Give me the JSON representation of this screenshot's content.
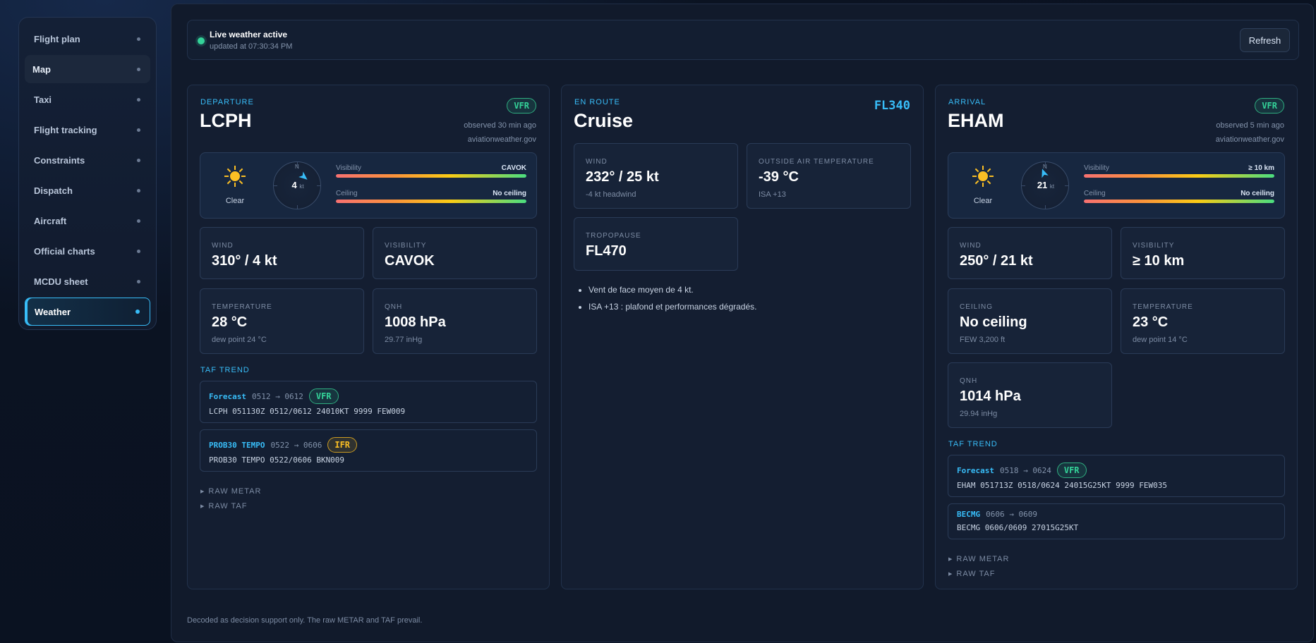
{
  "sidebar": {
    "items": [
      {
        "label": "Flight plan"
      },
      {
        "label": "Map"
      },
      {
        "label": "Taxi"
      },
      {
        "label": "Flight tracking"
      },
      {
        "label": "Constraints"
      },
      {
        "label": "Dispatch"
      },
      {
        "label": "Aircraft"
      },
      {
        "label": "Official charts"
      },
      {
        "label": "MCDU sheet"
      },
      {
        "label": "Weather"
      }
    ],
    "active": "Weather"
  },
  "status": {
    "title": "Live weather active",
    "updated": "updated at 07:30:34 PM",
    "refresh_label": "Refresh",
    "color": "#34d399"
  },
  "departure": {
    "label": "DEPARTURE",
    "code": "LCPH",
    "category": "VFR",
    "observed": "observed 30 min ago",
    "source": "aviationweather.gov",
    "sky": "Clear",
    "sky_icon": "sun-icon",
    "compass_n": "N",
    "wind_speed": "4",
    "wind_unit": "kt",
    "visibility_label": "Visibility",
    "visibility_short": "CAVOK",
    "ceiling_label": "Ceiling",
    "ceiling_short": "No ceiling",
    "tiles": {
      "wind_label": "WIND",
      "wind_value": "310° / 4 kt",
      "visibility_label": "VISIBILITY",
      "visibility_value": "CAVOK",
      "temperature_label": "TEMPERATURE",
      "temperature_value": "28 °C",
      "dew_point": "dew point 24 °C",
      "qnh_label": "QNH",
      "qnh_value": "1008 hPa",
      "qnh_inhg": "29.77 inHg"
    },
    "taf_title": "TAF TREND",
    "taf": [
      {
        "kind": "Forecast",
        "period": "0512 → 0612",
        "category": "VFR",
        "code": "LCPH 051130Z 0512/0612 24010KT 9999 FEW009"
      },
      {
        "kind": "PROB30 TEMPO",
        "period": "0522 → 0606",
        "category": "IFR",
        "code": "PROB30 TEMPO 0522/0606 BKN009"
      }
    ],
    "raw_metar": "RAW METAR",
    "raw_taf": "RAW TAF"
  },
  "enroute": {
    "label": "EN ROUTE",
    "title": "Cruise",
    "flight_level": "FL340",
    "tiles": {
      "wind_label": "WIND",
      "wind_value": "232° / 25 kt",
      "wind_sub": "-4 kt headwind",
      "oat_label": "OUTSIDE AIR TEMPERATURE",
      "oat_value": "-39 °C",
      "oat_sub": "ISA +13",
      "tropo_label": "TROPOPAUSE",
      "tropo_value": "FL470"
    },
    "notes": [
      "Vent de face moyen de 4 kt.",
      "ISA +13 : plafond et performances dégradés."
    ]
  },
  "arrival": {
    "label": "ARRIVAL",
    "code": "EHAM",
    "category": "VFR",
    "observed": "observed 5 min ago",
    "source": "aviationweather.gov",
    "sky": "Clear",
    "sky_icon": "sun-icon",
    "compass_n": "N",
    "wind_speed": "21",
    "wind_unit": "kt",
    "visibility_label": "Visibility",
    "visibility_short": "≥ 10 km",
    "ceiling_label": "Ceiling",
    "ceiling_short": "No ceiling",
    "tiles": {
      "wind_label": "WIND",
      "wind_value": "250° / 21 kt",
      "visibility_label": "VISIBILITY",
      "visibility_value": "≥ 10 km",
      "ceiling_label": "CEILING",
      "ceiling_value": "No ceiling",
      "ceiling_sub": "FEW 3,200 ft",
      "temperature_label": "TEMPERATURE",
      "temperature_value": "23 °C",
      "dew_point": "dew point 14 °C",
      "qnh_label": "QNH",
      "qnh_value": "1014 hPa",
      "qnh_inhg": "29.94 inHg"
    },
    "taf_title": "TAF TREND",
    "taf": [
      {
        "kind": "Forecast",
        "period": "0518 → 0624",
        "category": "VFR",
        "code": "EHAM 051713Z 0518/0624 24015G25KT 9999 FEW035"
      },
      {
        "kind": "BECMG",
        "period": "0606 → 0609",
        "category": "",
        "code": "BECMG 0606/0609 27015G25KT"
      }
    ],
    "raw_metar": "RAW METAR",
    "raw_taf": "RAW TAF"
  },
  "colors": {
    "accent": "#38bdf8",
    "vfr": "#34d399",
    "ifr": "#fbbf24"
  },
  "footer": "Decoded as decision support only. The raw METAR and TAF prevail."
}
